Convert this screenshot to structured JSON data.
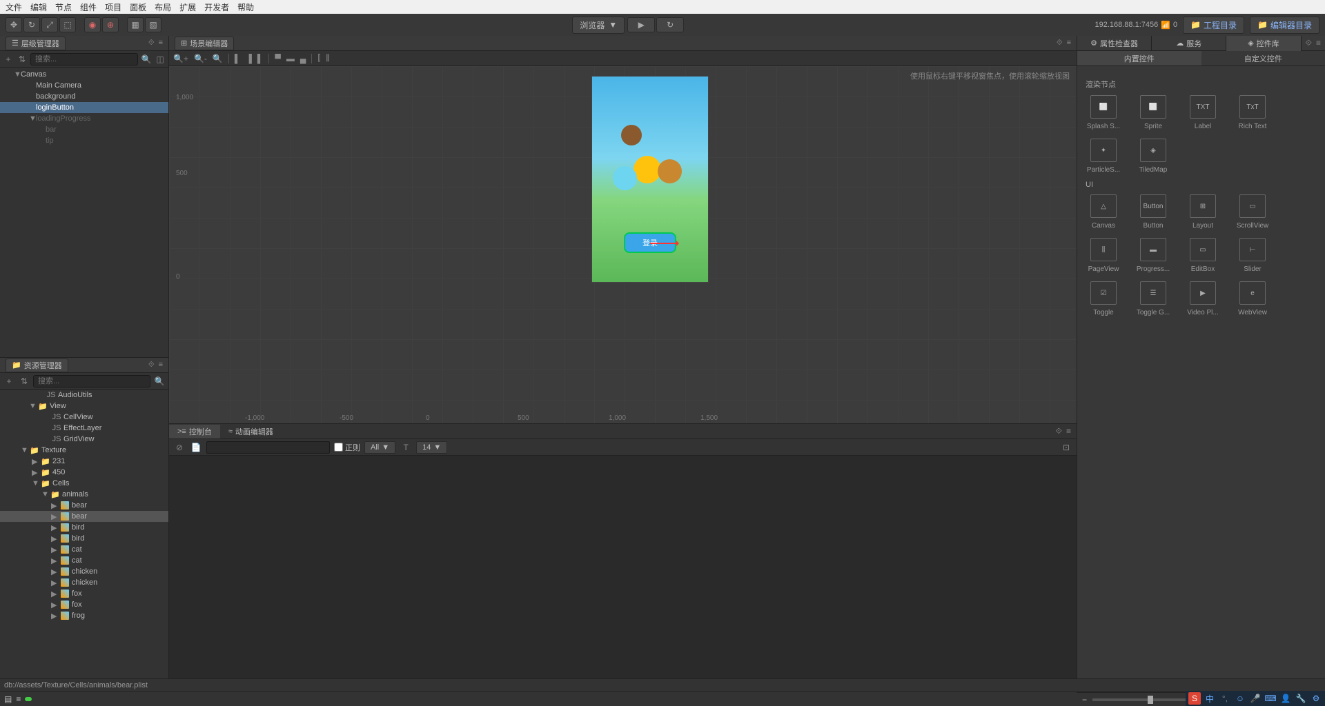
{
  "menubar": {
    "items": [
      "文件",
      "编辑",
      "节点",
      "组件",
      "项目",
      "面板",
      "布局",
      "扩展",
      "开发者",
      "帮助"
    ]
  },
  "toolbar": {
    "preview_label": "浏览器",
    "ip": "192.168.88.1:7456",
    "wifi_count": "0",
    "project_dir": "工程目录",
    "editor_dir": "编辑器目录"
  },
  "hierarchy": {
    "title": "层级管理器",
    "search_placeholder": "搜索...",
    "items": [
      {
        "label": "Canvas",
        "indent": 20,
        "arrow": "▼"
      },
      {
        "label": "Main Camera",
        "indent": 42,
        "arrow": ""
      },
      {
        "label": "background",
        "indent": 42,
        "arrow": ""
      },
      {
        "label": "loginButton",
        "indent": 42,
        "arrow": "",
        "selected": true
      },
      {
        "label": "loadingProgress",
        "indent": 42,
        "arrow": "▼",
        "disabled": true
      },
      {
        "label": "bar",
        "indent": 56,
        "arrow": "",
        "disabled": true
      },
      {
        "label": "tip",
        "indent": 56,
        "arrow": "",
        "disabled": true
      }
    ]
  },
  "assets": {
    "title": "资源管理器",
    "search_placeholder": "搜索...",
    "items": [
      {
        "label": "AudioUtils",
        "indent": 54,
        "type": "script"
      },
      {
        "label": "View",
        "indent": 42,
        "type": "folder",
        "arrow": "▼"
      },
      {
        "label": "CellView",
        "indent": 62,
        "type": "script"
      },
      {
        "label": "EffectLayer",
        "indent": 62,
        "type": "script"
      },
      {
        "label": "GridView",
        "indent": 62,
        "type": "script"
      },
      {
        "label": "Texture",
        "indent": 30,
        "type": "folder",
        "arrow": "▼"
      },
      {
        "label": "231",
        "indent": 46,
        "type": "folder",
        "arrow": "▶"
      },
      {
        "label": "450",
        "indent": 46,
        "type": "folder",
        "arrow": "▶"
      },
      {
        "label": "Cells",
        "indent": 46,
        "type": "folder",
        "arrow": "▼"
      },
      {
        "label": "animals",
        "indent": 60,
        "type": "folder",
        "arrow": "▼"
      },
      {
        "label": "bear",
        "indent": 74,
        "type": "img",
        "arrow": "▶"
      },
      {
        "label": "bear",
        "indent": 74,
        "type": "img",
        "arrow": "▶",
        "selected": true
      },
      {
        "label": "bird",
        "indent": 74,
        "type": "img",
        "arrow": "▶"
      },
      {
        "label": "bird",
        "indent": 74,
        "type": "img",
        "arrow": "▶"
      },
      {
        "label": "cat",
        "indent": 74,
        "type": "img",
        "arrow": "▶"
      },
      {
        "label": "cat",
        "indent": 74,
        "type": "img",
        "arrow": "▶"
      },
      {
        "label": "chicken",
        "indent": 74,
        "type": "img",
        "arrow": "▶"
      },
      {
        "label": "chicken",
        "indent": 74,
        "type": "img",
        "arrow": "▶"
      },
      {
        "label": "fox",
        "indent": 74,
        "type": "img",
        "arrow": "▶"
      },
      {
        "label": "fox",
        "indent": 74,
        "type": "img",
        "arrow": "▶"
      },
      {
        "label": "frog",
        "indent": 74,
        "type": "img",
        "arrow": "▶"
      }
    ]
  },
  "scene": {
    "title": "场景编辑器",
    "hint": "使用鼠标右键平移视窗焦点，使用滚轮缩放视图",
    "ruler_y": [
      "1,000",
      "500",
      "0"
    ],
    "ruler_x": [
      "-1,000",
      "-500",
      "0",
      "500",
      "1,000",
      "1,500"
    ],
    "login_text": "登录"
  },
  "console": {
    "tab_console": "控制台",
    "tab_anim": "动画编辑器",
    "regex_label": "正则",
    "filter_all": "All",
    "font_size": "14"
  },
  "inspector": {
    "tab_inspector": "属性检查器",
    "tab_service": "服务",
    "tab_controls": "控件库",
    "subtab_builtin": "内置控件",
    "subtab_custom": "自定义控件",
    "section_render": "渲染节点",
    "section_ui": "UI",
    "render_controls": [
      {
        "label": "Splash S...",
        "icon": "⬜"
      },
      {
        "label": "Sprite",
        "icon": "⬜"
      },
      {
        "label": "Label",
        "icon": "TXT"
      },
      {
        "label": "Rich Text",
        "icon": "TxT"
      },
      {
        "label": "ParticleS...",
        "icon": "✦"
      },
      {
        "label": "TiledMap",
        "icon": "◈"
      }
    ],
    "ui_controls": [
      {
        "label": "Canvas",
        "icon": "△"
      },
      {
        "label": "Button",
        "icon": "Button"
      },
      {
        "label": "Layout",
        "icon": "⊞"
      },
      {
        "label": "ScrollView",
        "icon": "▭"
      },
      {
        "label": "PageView",
        "icon": "⫼"
      },
      {
        "label": "Progress...",
        "icon": "▬"
      },
      {
        "label": "EditBox",
        "icon": "▭"
      },
      {
        "label": "Slider",
        "icon": "⊢"
      },
      {
        "label": "Toggle",
        "icon": "☑"
      },
      {
        "label": "Toggle G...",
        "icon": "☰"
      },
      {
        "label": "Video Pl...",
        "icon": "▶"
      },
      {
        "label": "WebView",
        "icon": "e"
      }
    ]
  },
  "zoom": {
    "value": "1"
  },
  "statusbar": {
    "path": "db://assets/Texture/Cells/animals/bear.plist"
  }
}
